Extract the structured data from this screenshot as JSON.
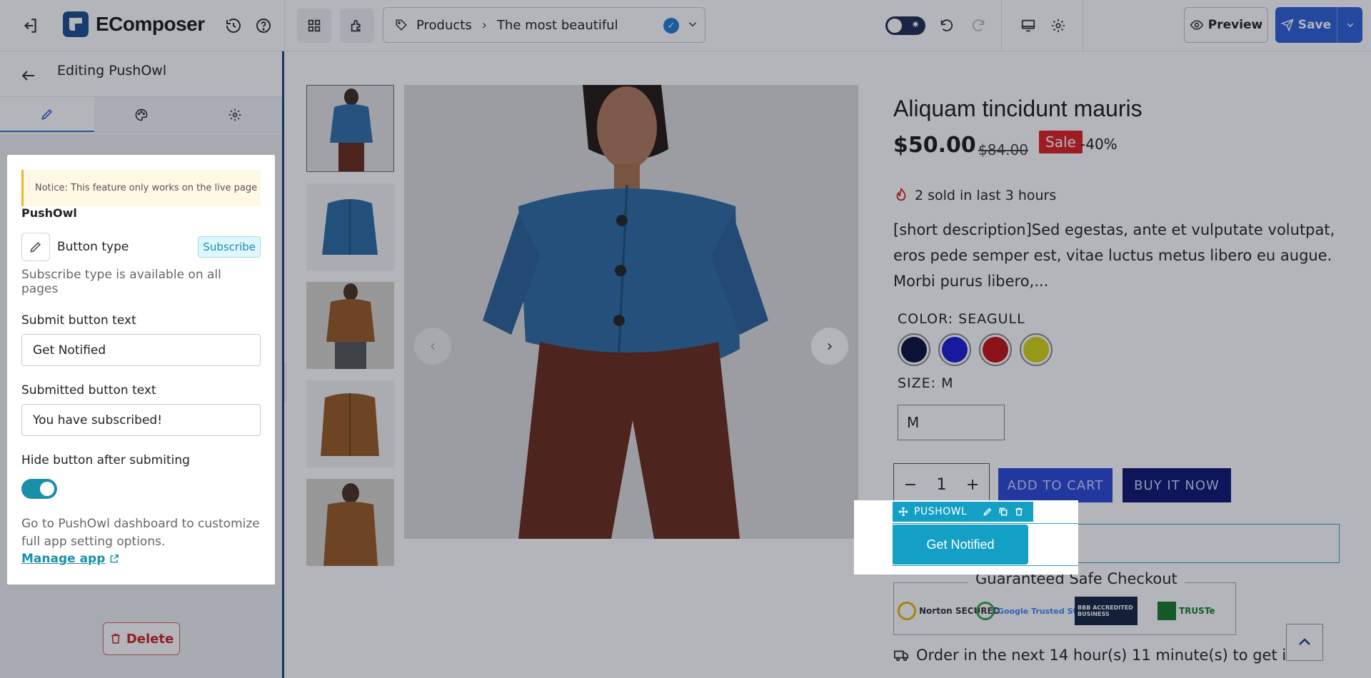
{
  "app": {
    "name": "EComposer"
  },
  "topbar": {
    "breadcrumb": [
      "Products",
      "The most beautiful"
    ],
    "preview_label": "Preview",
    "save_label": "Save"
  },
  "left_panel": {
    "title": "Editing PushOwl",
    "tabs": [
      "content-icon",
      "style-icon",
      "settings-icon"
    ],
    "notice": "Notice: This feature only works on the live page",
    "section_title": "PushOwl",
    "button_type_label": "Button type",
    "button_type_value": "Subscribe",
    "button_type_hint": "Subscribe type is available on all pages",
    "submit_label": "Submit button text",
    "submit_value": "Get Notified",
    "submitted_label": "Submitted button text",
    "submitted_value": "You have subscribed!",
    "hide_label": "Hide button after submiting",
    "hide_enabled": true,
    "more_info": "Go to PushOwl dashboard to customize full app setting options.",
    "manage_link": "Manage app",
    "delete_label": "Delete"
  },
  "product": {
    "title": "Aliquam tincidunt mauris",
    "price": "$50.00",
    "compare_price": "$84.00",
    "sale_badge": "Sale",
    "discount": "-40%",
    "sold_text": "2 sold in last 3 hours",
    "description": "[short description]Sed egestas, ante et vulputate volutpat, eros pede semper est, vitae luctus metus libero eu augue. Morbi purus libero,...",
    "color_label": "COLOR: SEAGULL",
    "colors": [
      "#0b0f3a",
      "#1a1ad6",
      "#c41010",
      "#d6d40f"
    ],
    "size_label": "SIZE: M",
    "size_value": "M",
    "quantity": "1",
    "add_to_cart": "ADD TO CART",
    "buy_now": "BUY IT NOW",
    "guarantee_title": "Guaranteed Safe Checkout",
    "badges": [
      "Norton SECURED",
      "Google Trusted Store",
      "BBB ACCREDITED BUSINESS",
      "TRUSTe"
    ],
    "order_text": "Order in the next 14 hour(s) 11 minute(s) to get it"
  },
  "pushowl_widget": {
    "toolbar_label": "PUSHOWL",
    "button_label": "Get Notified"
  }
}
